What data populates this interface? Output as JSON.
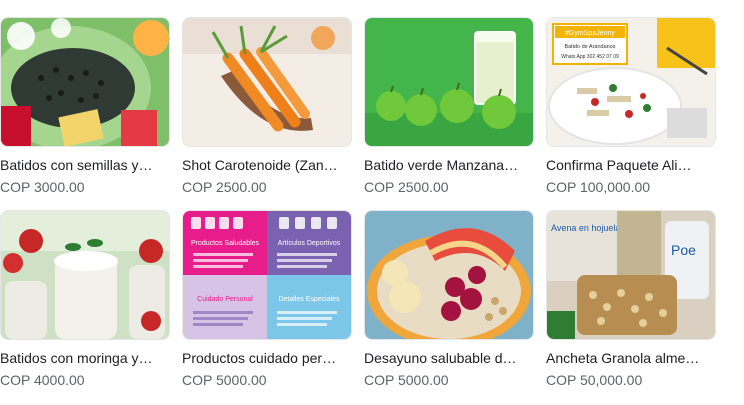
{
  "products": [
    {
      "title": "Batidos con semillas y…",
      "price": "COP 3000.00"
    },
    {
      "title": "Shot Carotenoide (Zan…",
      "price": "COP 2500.00"
    },
    {
      "title": "Batido verde Manzana…",
      "price": "COP 2500.00"
    },
    {
      "title": "Confirma Paquete Ali…",
      "price": "COP 100,000.00"
    },
    {
      "title": "Batidos con moringa y…",
      "price": "COP 4000.00"
    },
    {
      "title": "Productos cuidado per…",
      "price": "COP 5000.00"
    },
    {
      "title": "Desayuno salubable d…",
      "price": "COP 5000.00"
    },
    {
      "title": "Ancheta Granola alme…",
      "price": "COP 50,000.00"
    }
  ],
  "thumbnail_text": {
    "promo_tag": "#GymSpaJenny",
    "promo_sub": "Batido de Arandanos",
    "promo_phone": "Whats App 302 452 07 09",
    "poster_left": "Productos Saludables",
    "poster_right": "Artículos Deportivos",
    "poster_bottom_left": "Cuidado Personal",
    "poster_bottom_right": "Detalles Especiales",
    "pack_label_1": "Avena en hojuelas",
    "pack_label_2": "Poe"
  }
}
